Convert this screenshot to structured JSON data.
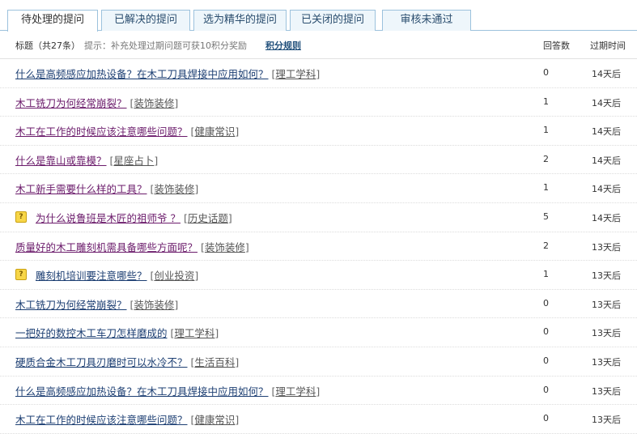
{
  "tabs": [
    {
      "label": "待处理的提问",
      "active": true
    },
    {
      "label": "已解决的提问",
      "active": false
    },
    {
      "label": "选为精华的提问",
      "active": false
    },
    {
      "label": "已关闭的提问",
      "active": false
    },
    {
      "label": "审核未通过",
      "active": false
    }
  ],
  "header": {
    "title": "标题（共27条）",
    "hint": "提示：补充处理过期问题可获10积分奖励",
    "rule_link": "积分规则",
    "col_answers": "回答数",
    "col_expire": "过期时间"
  },
  "rows": [
    {
      "title": "什么是高频感应加热设备？在木工刀具焊接中应用如何？",
      "category": "理工学科",
      "answers": "0",
      "expire": "14天后",
      "icon": false,
      "visited": false
    },
    {
      "title": "木工铣刀为何经常崩裂？",
      "category": "装饰装修",
      "answers": "1",
      "expire": "14天后",
      "icon": false,
      "visited": true
    },
    {
      "title": "木工在工作的时候应该注意哪些问题？",
      "category": "健康常识",
      "answers": "1",
      "expire": "14天后",
      "icon": false,
      "visited": true
    },
    {
      "title": "什么是靠山或靠模？",
      "category": "星座占卜",
      "answers": "2",
      "expire": "14天后",
      "icon": false,
      "visited": true
    },
    {
      "title": "木工新手需要什么样的工具？",
      "category": "装饰装修",
      "answers": "1",
      "expire": "14天后",
      "icon": false,
      "visited": true
    },
    {
      "title": "为什么说鲁班是木匠的祖师爷 ？",
      "category": "历史话题",
      "answers": "5",
      "expire": "14天后",
      "icon": true,
      "visited": true
    },
    {
      "title": "质量好的木工雕刻机需具备哪些方面呢？",
      "category": "装饰装修",
      "answers": "2",
      "expire": "13天后",
      "icon": false,
      "visited": true
    },
    {
      "title": "雕刻机培训要注意哪些？",
      "category": "创业投资",
      "answers": "1",
      "expire": "13天后",
      "icon": true,
      "visited": false
    },
    {
      "title": "木工铣刀为何经常崩裂？",
      "category": "装饰装修",
      "answers": "0",
      "expire": "13天后",
      "icon": false,
      "visited": false
    },
    {
      "title": "一把好的数控木工车刀怎样磨成的",
      "category": "理工学科",
      "answers": "0",
      "expire": "13天后",
      "icon": false,
      "visited": false
    },
    {
      "title": "硬质合金木工刀具刃磨时可以水冷不？",
      "category": "生活百科",
      "answers": "0",
      "expire": "13天后",
      "icon": false,
      "visited": false
    },
    {
      "title": "什么是高频感应加热设备？在木工刀具焊接中应用如何？",
      "category": "理工学科",
      "answers": "0",
      "expire": "13天后",
      "icon": false,
      "visited": false
    },
    {
      "title": "木工在工作的时候应该注意哪些问题？",
      "category": "健康常识",
      "answers": "0",
      "expire": "13天后",
      "icon": false,
      "visited": false
    }
  ]
}
